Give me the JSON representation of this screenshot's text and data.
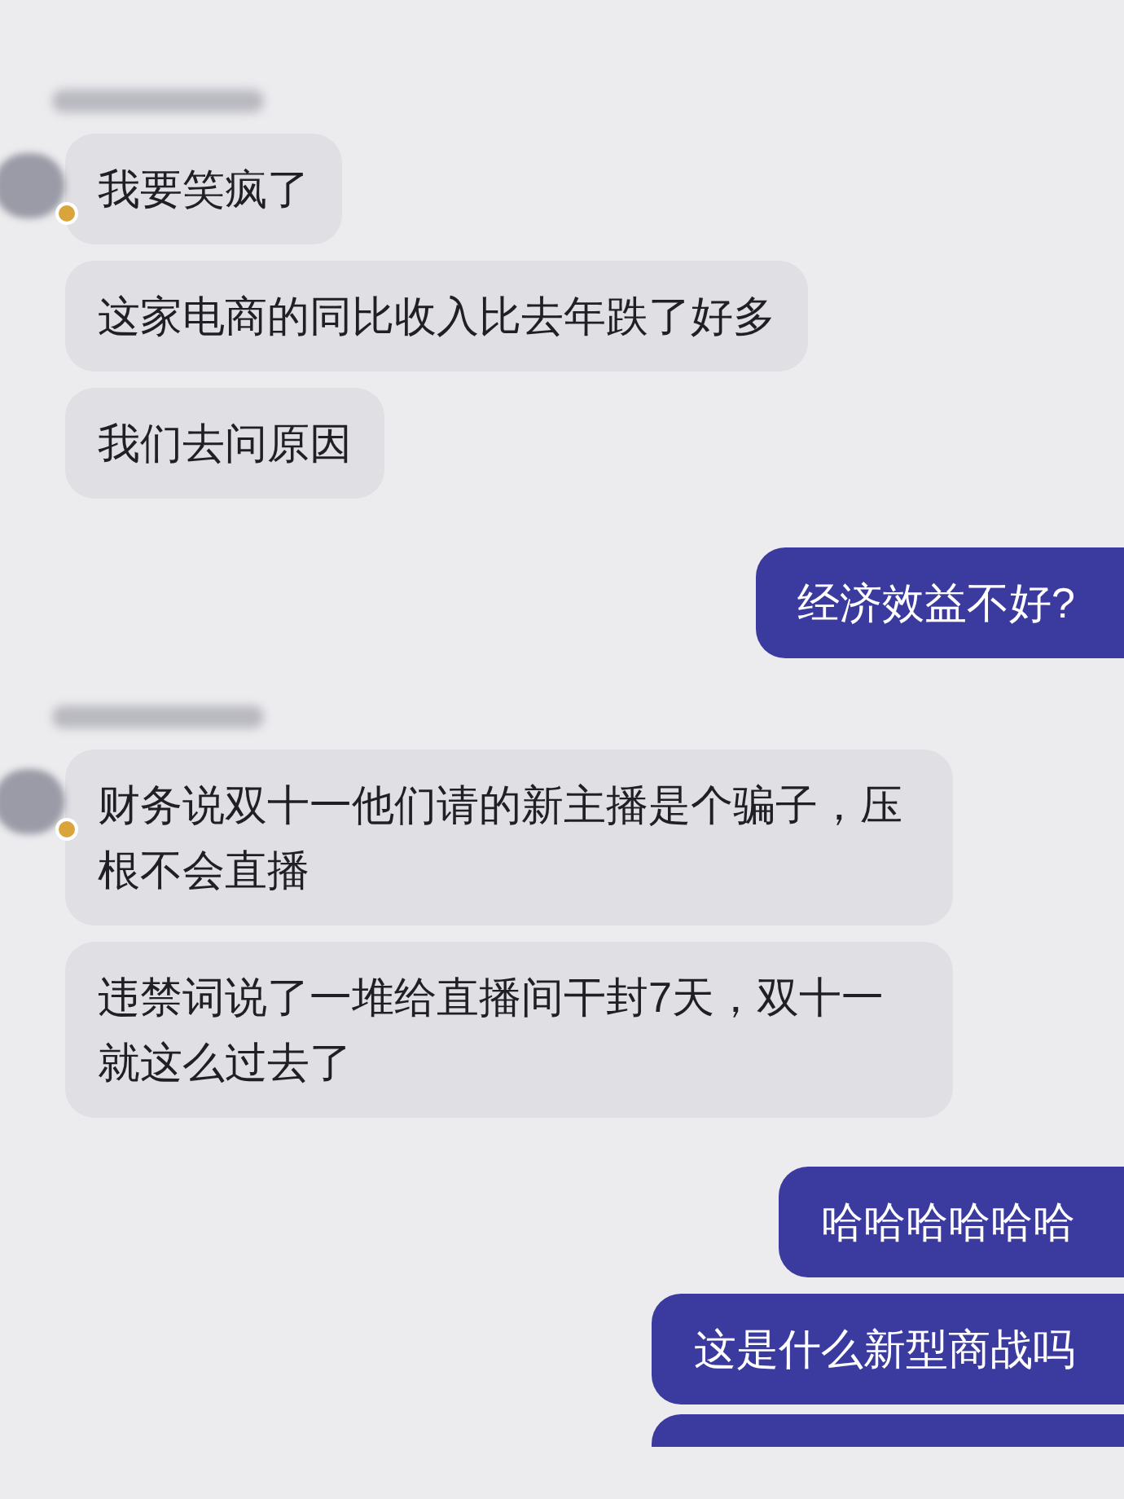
{
  "messages": [
    {
      "kind": "sender"
    },
    {
      "kind": "incoming",
      "text": "我要笑疯了"
    },
    {
      "kind": "incoming",
      "text": "这家电商的同比收入比去年跌了好多"
    },
    {
      "kind": "incoming",
      "text": "我们去问原因"
    },
    {
      "kind": "outgoing",
      "text": "经济效益不好?"
    },
    {
      "kind": "sender"
    },
    {
      "kind": "incoming",
      "text": "财务说双十一他们请的新主播是个骗子，压根不会直播"
    },
    {
      "kind": "incoming",
      "text": "违禁词说了一堆给直播间干封7天，双十一就这么过去了"
    },
    {
      "kind": "outgoing",
      "text": "哈哈哈哈哈哈"
    },
    {
      "kind": "outgoing",
      "text": "这是什么新型商战吗"
    },
    {
      "kind": "outgoing_cut"
    }
  ]
}
